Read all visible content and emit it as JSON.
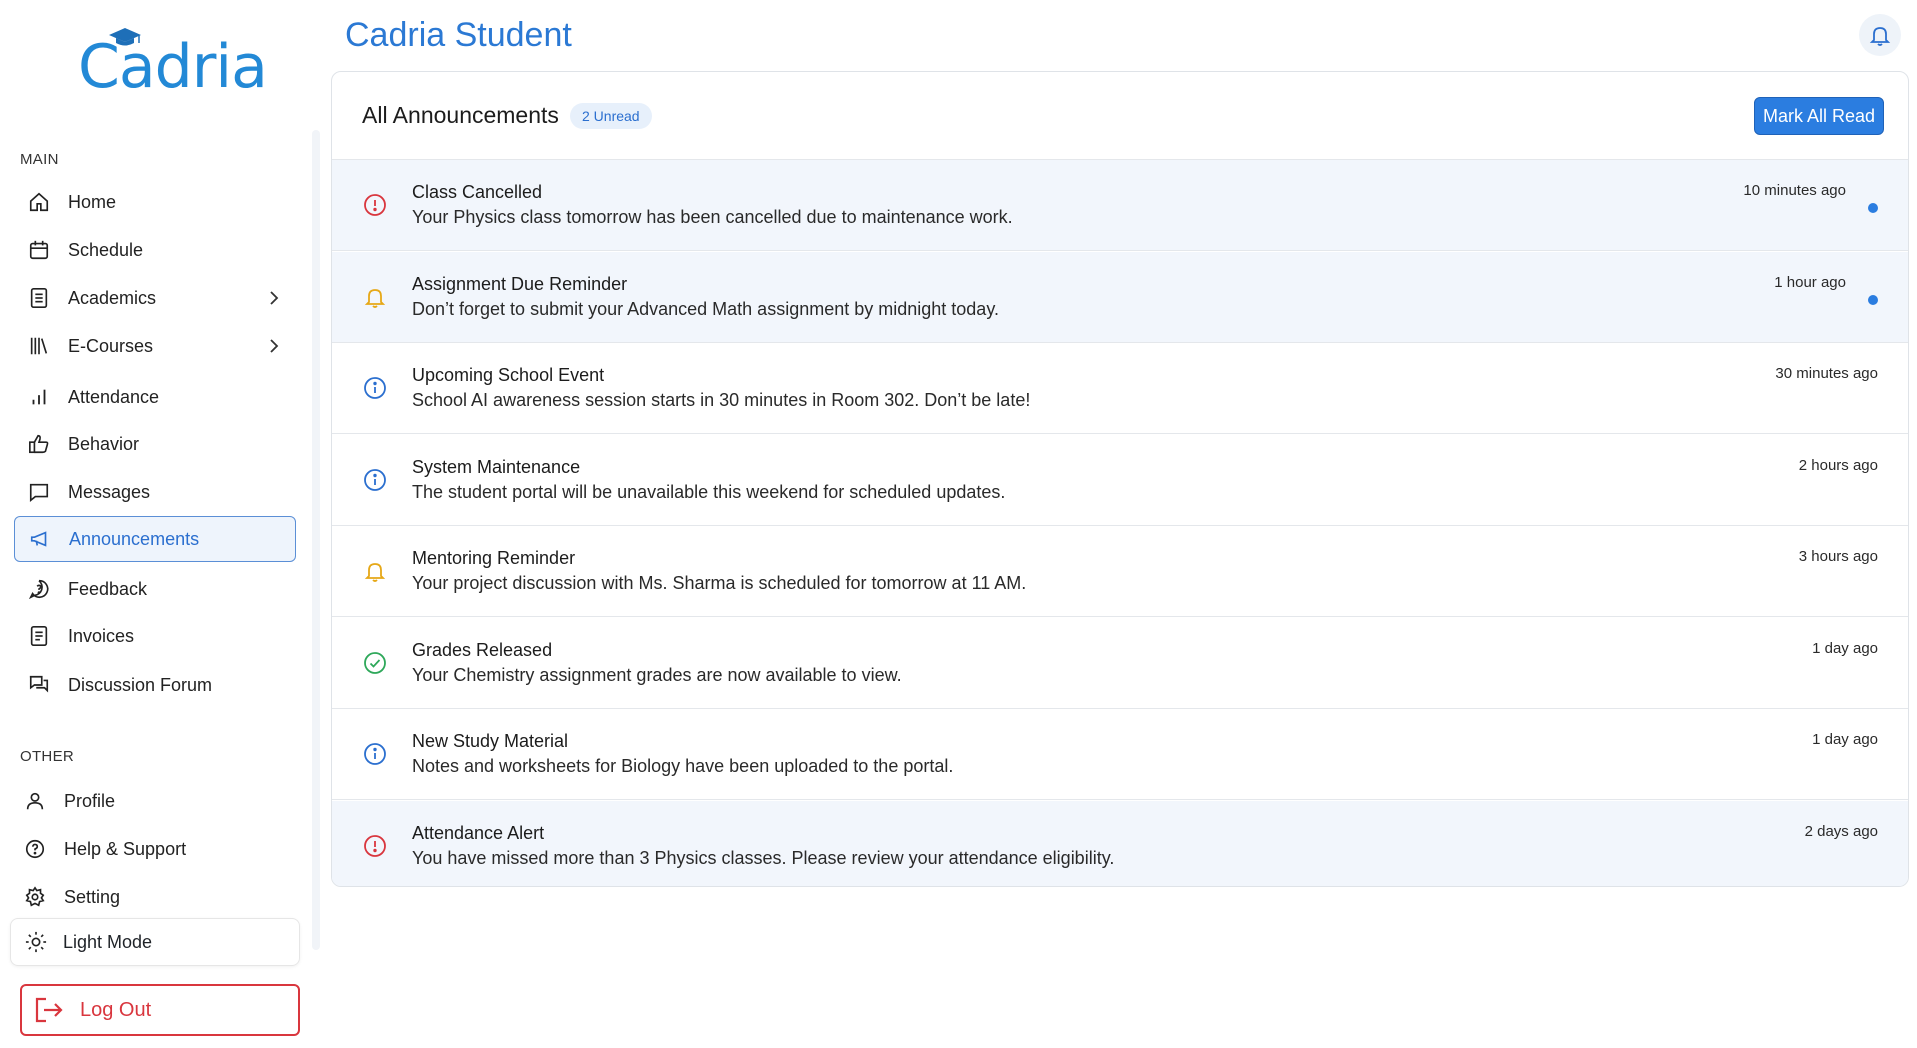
{
  "brand": {
    "logo_text": "Cadria"
  },
  "sidebar": {
    "main_label": "MAIN",
    "other_label": "OTHER",
    "main_items": [
      {
        "label": "Home",
        "icon": "home-icon"
      },
      {
        "label": "Schedule",
        "icon": "calendar-icon"
      },
      {
        "label": "Academics",
        "icon": "document-icon",
        "expandable": true
      },
      {
        "label": "E-Courses",
        "icon": "books-icon",
        "expandable": true
      },
      {
        "label": "Attendance",
        "icon": "bar-chart-icon"
      },
      {
        "label": "Behavior",
        "icon": "thumbs-up-icon"
      },
      {
        "label": "Messages",
        "icon": "message-icon"
      },
      {
        "label": "Announcements",
        "icon": "megaphone-icon",
        "active": true
      },
      {
        "label": "Feedback",
        "icon": "feedback-icon"
      },
      {
        "label": "Invoices",
        "icon": "invoice-icon"
      },
      {
        "label": "Discussion Forum",
        "icon": "forum-icon"
      }
    ],
    "other_items": [
      {
        "label": "Profile",
        "icon": "user-icon"
      },
      {
        "label": "Help & Support",
        "icon": "help-icon"
      },
      {
        "label": "Setting",
        "icon": "gear-icon"
      }
    ],
    "theme_toggle": {
      "label": "Light Mode",
      "icon": "sun-icon"
    },
    "logout": {
      "label": "Log Out",
      "icon": "logout-icon"
    }
  },
  "header": {
    "title": "Cadria Student",
    "notification_icon": "bell-icon"
  },
  "announcements": {
    "title": "All Announcements",
    "unread_badge": "2 Unread",
    "mark_all_read": "Mark All Read",
    "items": [
      {
        "title": "Class Cancelled",
        "message": "Your Physics class tomorrow has been cancelled due to maintenance work.",
        "time": "10 minutes ago",
        "type": "alert",
        "unread": true
      },
      {
        "title": "Assignment Due Reminder",
        "message": "Don’t forget to submit your Advanced Math assignment by midnight today.",
        "time": "1 hour ago",
        "type": "reminder",
        "unread": true
      },
      {
        "title": "Upcoming School Event",
        "message": "School AI awareness session starts in 30 minutes in Room 302. Don’t be late!",
        "time": "30 minutes ago",
        "type": "info",
        "unread": false
      },
      {
        "title": "System Maintenance",
        "message": "The student portal will be unavailable this weekend for scheduled updates.",
        "time": "2 hours ago",
        "type": "info",
        "unread": false
      },
      {
        "title": "Mentoring Reminder",
        "message": "Your project discussion with Ms. Sharma is scheduled for tomorrow at 11 AM.",
        "time": "3 hours ago",
        "type": "reminder",
        "unread": false
      },
      {
        "title": "Grades Released",
        "message": "Your Chemistry assignment grades are now available to view.",
        "time": "1 day ago",
        "type": "success",
        "unread": false
      },
      {
        "title": "New Study Material",
        "message": "Notes and worksheets for Biology have been uploaded to the portal.",
        "time": "1 day ago",
        "type": "info",
        "unread": false
      },
      {
        "title": "Attendance Alert",
        "message": "You have missed more than 3 Physics classes. Please review your attendance eligibility.",
        "time": "2 days ago",
        "type": "alert",
        "unread": false,
        "highlighted": true
      }
    ]
  },
  "colors": {
    "accent": "#2b7de0",
    "alert": "#d9363e",
    "reminder": "#e6a817",
    "info": "#2b6fcf",
    "success": "#2ea85a"
  }
}
